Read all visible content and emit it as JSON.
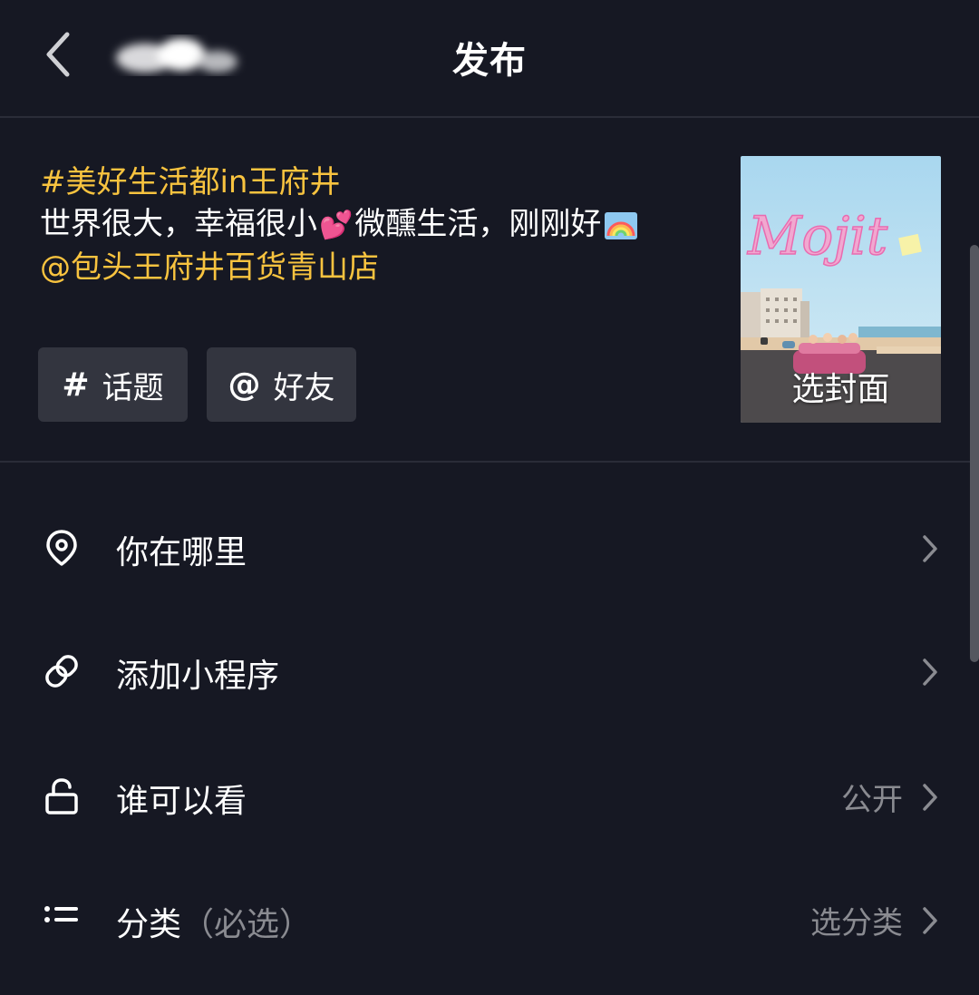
{
  "header": {
    "title": "发布"
  },
  "caption": {
    "hashtag": "#美好生活都in王府井",
    "line2_a": "世界很大，幸福很小",
    "line2_b": "微醺生活，刚刚好",
    "mention": "@包头王府井百货青山店"
  },
  "chips": {
    "topic_icon": "#",
    "topic_label": "话题",
    "friend_icon": "@",
    "friend_label": "好友"
  },
  "cover": {
    "label": "选封面",
    "logo_text": "Mojit"
  },
  "settings": {
    "location": {
      "label": "你在哪里",
      "icon": "location-pin-icon"
    },
    "miniapp": {
      "label": "添加小程序",
      "icon": "link-icon"
    },
    "privacy": {
      "label": "谁可以看",
      "value": "公开",
      "icon": "unlock-icon"
    },
    "category": {
      "label": "分类",
      "required": "（必选）",
      "value": "选分类",
      "icon": "list-icon"
    }
  },
  "colors": {
    "background": "#161823",
    "accent": "#f8c33f",
    "chip": "#33353f",
    "muted": "#8a8b91"
  }
}
